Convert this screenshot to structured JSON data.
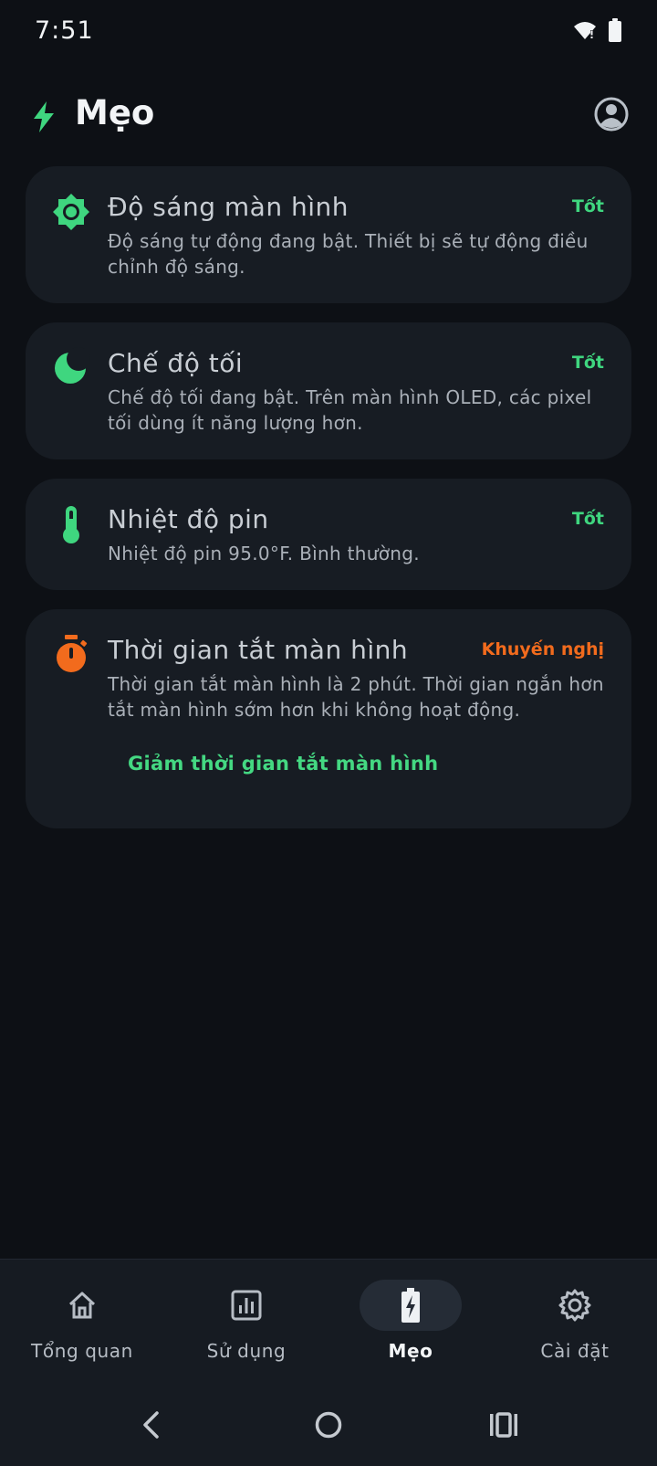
{
  "status_bar": {
    "time": "7:51",
    "icons": [
      "wifi-icon",
      "battery-icon"
    ]
  },
  "header": {
    "title": "Mẹo",
    "icon": "lightning-bolt-icon",
    "profile_icon": "account-circle-icon"
  },
  "colors": {
    "accent_green": "#3fd67f",
    "warning_orange": "#f26b1d",
    "background": "#0d1015",
    "card": "#171c23"
  },
  "tips": [
    {
      "icon": "brightness-sun-icon",
      "title": "Độ sáng màn hình",
      "status": "Tốt",
      "description": "Độ sáng tự động đang bật. Thiết bị sẽ tự động điều chỉnh độ sáng."
    },
    {
      "icon": "moon-icon",
      "title": "Chế độ tối",
      "status": "Tốt",
      "description": "Chế độ tối đang bật. Trên màn hình OLED, các pixel tối dùng ít năng lượng hơn."
    },
    {
      "icon": "thermometer-icon",
      "title": "Nhiệt độ pin",
      "status": "Tốt",
      "description": "Nhiệt độ pin 95.0°F. Bình thường."
    },
    {
      "icon": "timer-icon",
      "title": "Thời gian tắt màn hình",
      "status": "Khuyến nghị",
      "description": "Thời gian tắt màn hình là 2 phút. Thời gian ngắn hơn tắt màn hình sớm hơn khi không hoạt động.",
      "action": "Giảm thời gian tắt màn hình"
    }
  ],
  "bottom_nav": {
    "items": [
      {
        "label": "Tổng quan",
        "icon": "home-icon",
        "active": false
      },
      {
        "label": "Sử dụng",
        "icon": "bar-chart-icon",
        "active": false
      },
      {
        "label": "Mẹo",
        "icon": "battery-charging-icon",
        "active": true
      },
      {
        "label": "Cài đặt",
        "icon": "gear-icon",
        "active": false
      }
    ]
  },
  "system_nav": [
    "back-icon",
    "home-circle-icon",
    "recents-icon"
  ]
}
